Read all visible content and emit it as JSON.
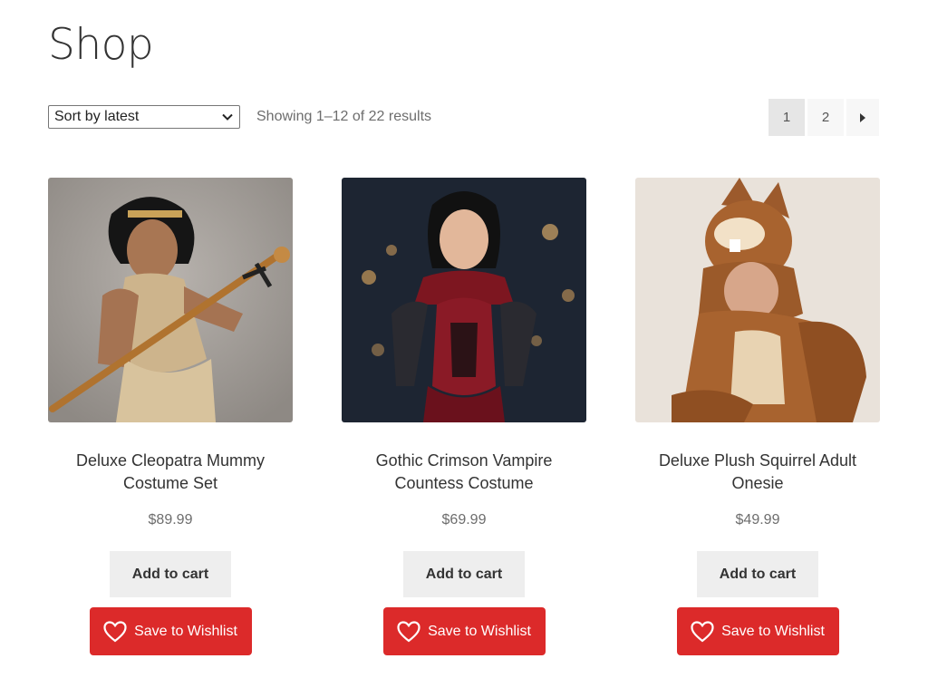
{
  "page": {
    "title": "Shop"
  },
  "toolbar": {
    "sort_selected": "Sort by latest",
    "result_count": "Showing 1–12 of 22 results"
  },
  "pagination": {
    "current": "1",
    "pages": [
      "2"
    ],
    "next_icon": "triangle-right-icon"
  },
  "products": [
    {
      "name": "Deluxe Cleopatra Mummy Costume Set",
      "price": "$89.99",
      "add_to_cart": "Add to cart",
      "wishlist": "Save to Wishlist",
      "image_alt": "Cleopatra costume"
    },
    {
      "name": "Gothic Crimson Vampire Countess Costume",
      "price": "$69.99",
      "add_to_cart": "Add to cart",
      "wishlist": "Save to Wishlist",
      "image_alt": "Vampire countess costume"
    },
    {
      "name": "Deluxe Plush Squirrel Adult Onesie",
      "price": "$49.99",
      "add_to_cart": "Add to cart",
      "wishlist": "Save to Wishlist",
      "image_alt": "Squirrel onesie"
    }
  ],
  "colors": {
    "wishlist_button": "#dc2a2a",
    "cart_button": "#eeeeee",
    "pager_current": "#e6e6e6"
  },
  "icons": {
    "wishlist": "heart-icon",
    "sort": "chevron-down-icon"
  }
}
